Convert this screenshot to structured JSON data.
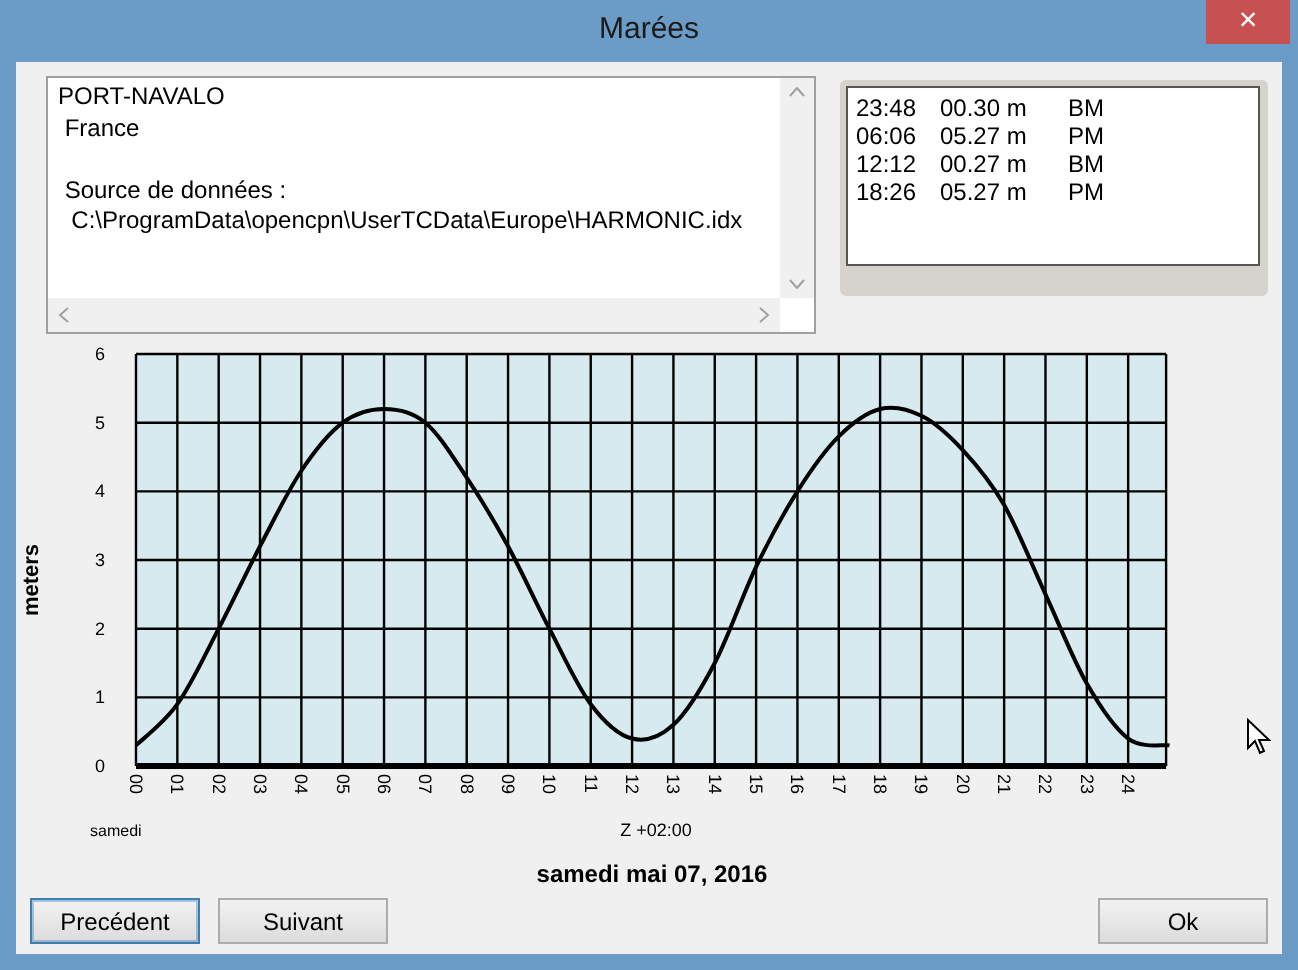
{
  "window": {
    "title": "Marées",
    "close": "×"
  },
  "station": {
    "lines": [
      "PORT-NAVALO",
      " France"
    ],
    "source_lines": [
      " Source de données :",
      "  C:\\ProgramData\\opencpn\\UserTCData\\Europe\\HARMONIC.idx"
    ]
  },
  "tides": [
    {
      "time": "23:48",
      "height": "00.30 m",
      "type": "BM"
    },
    {
      "time": "06:06",
      "height": "05.27 m",
      "type": "PM"
    },
    {
      "time": "12:12",
      "height": "00.27 m",
      "type": "BM"
    },
    {
      "time": "18:26",
      "height": "05.27 m",
      "type": "PM"
    }
  ],
  "chart": {
    "day_label": "samedi",
    "timezone_label": "Z +02:00",
    "chart_data": {
      "type": "line",
      "title": "samedi mai 07, 2016",
      "ylabel": "meters",
      "x": [
        0,
        1,
        2,
        3,
        4,
        5,
        6,
        7,
        8,
        9,
        10,
        11,
        12,
        13,
        14,
        15,
        16,
        17,
        18,
        19,
        20,
        21,
        22,
        23,
        24,
        25
      ],
      "grid": true,
      "series": [
        {
          "color": "#000000",
          "values": [
            0.3,
            0.9,
            2.0,
            3.2,
            4.3,
            5.0,
            5.2,
            5.0,
            4.2,
            3.2,
            2.0,
            0.9,
            0.4,
            0.6,
            1.5,
            2.9,
            4.0,
            4.8,
            5.2,
            5.1,
            4.6,
            3.8,
            2.5,
            1.2,
            0.4,
            0.3
          ]
        }
      ],
      "xlim": [
        0,
        25
      ],
      "ylim": [
        0,
        6
      ],
      "yticks": [
        0,
        1,
        2,
        3,
        4,
        5,
        6
      ],
      "xticks": [
        {
          "value": 0,
          "label": "00"
        },
        {
          "value": 1,
          "label": "01"
        },
        {
          "value": 2,
          "label": "02"
        },
        {
          "value": 3,
          "label": "03"
        },
        {
          "value": 4,
          "label": "04"
        },
        {
          "value": 5,
          "label": "05"
        },
        {
          "value": 6,
          "label": "06"
        },
        {
          "value": 7,
          "label": "07"
        },
        {
          "value": 8,
          "label": "08"
        },
        {
          "value": 9,
          "label": "09"
        },
        {
          "value": 10,
          "label": "10"
        },
        {
          "value": 11,
          "label": "11"
        },
        {
          "value": 12,
          "label": "12"
        },
        {
          "value": 13,
          "label": "13"
        },
        {
          "value": 14,
          "label": "14"
        },
        {
          "value": 15,
          "label": "15"
        },
        {
          "value": 16,
          "label": "16"
        },
        {
          "value": 17,
          "label": "17"
        },
        {
          "value": 18,
          "label": "18"
        },
        {
          "value": 19,
          "label": "19"
        },
        {
          "value": 20,
          "label": "20"
        },
        {
          "value": 21,
          "label": "21"
        },
        {
          "value": 22,
          "label": "22"
        },
        {
          "value": 23,
          "label": "23"
        },
        {
          "value": 24,
          "label": "24"
        }
      ]
    }
  },
  "buttons": [
    {
      "label": "Precédent",
      "focused": true
    },
    {
      "label": "Suivant",
      "focused": false
    },
    {
      "label": "Ok",
      "focused": false
    }
  ]
}
